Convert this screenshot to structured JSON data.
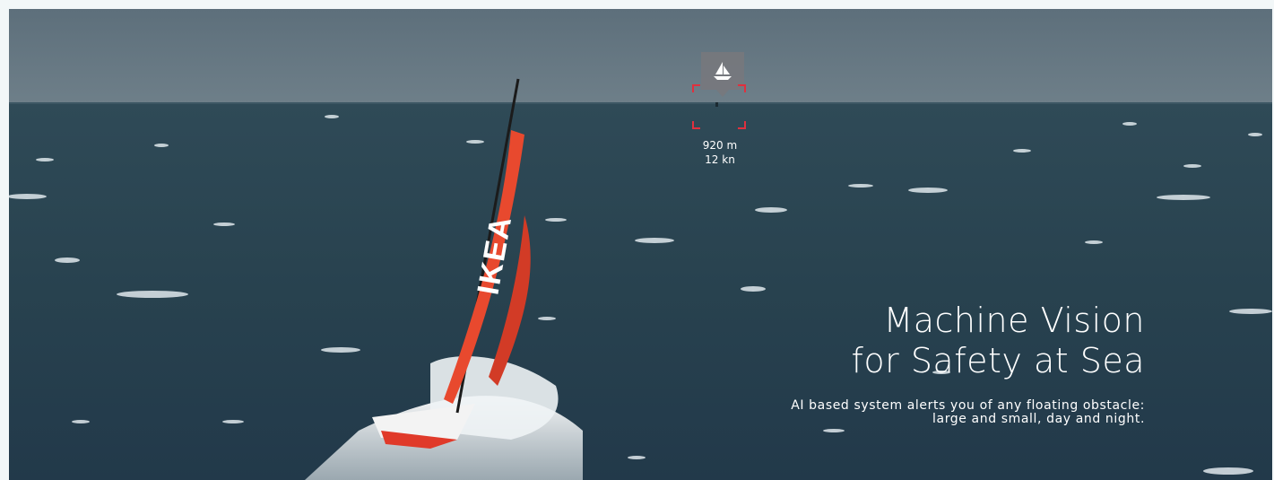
{
  "hero": {
    "headline": "Machine Vision\nfor Safety at Sea",
    "subline": "AI based system alerts you of any floating obstacle:\nlarge and small, day and night."
  },
  "detection": {
    "icon": "sailboat-icon",
    "distance": "920 m",
    "speed": "12 kn",
    "bracket_color": "#e0303e"
  },
  "sail": {
    "lettering": "IKEA"
  },
  "colors": {
    "sky": "#4f6470",
    "sea": "#2b4552",
    "sail": "#e8492e"
  }
}
